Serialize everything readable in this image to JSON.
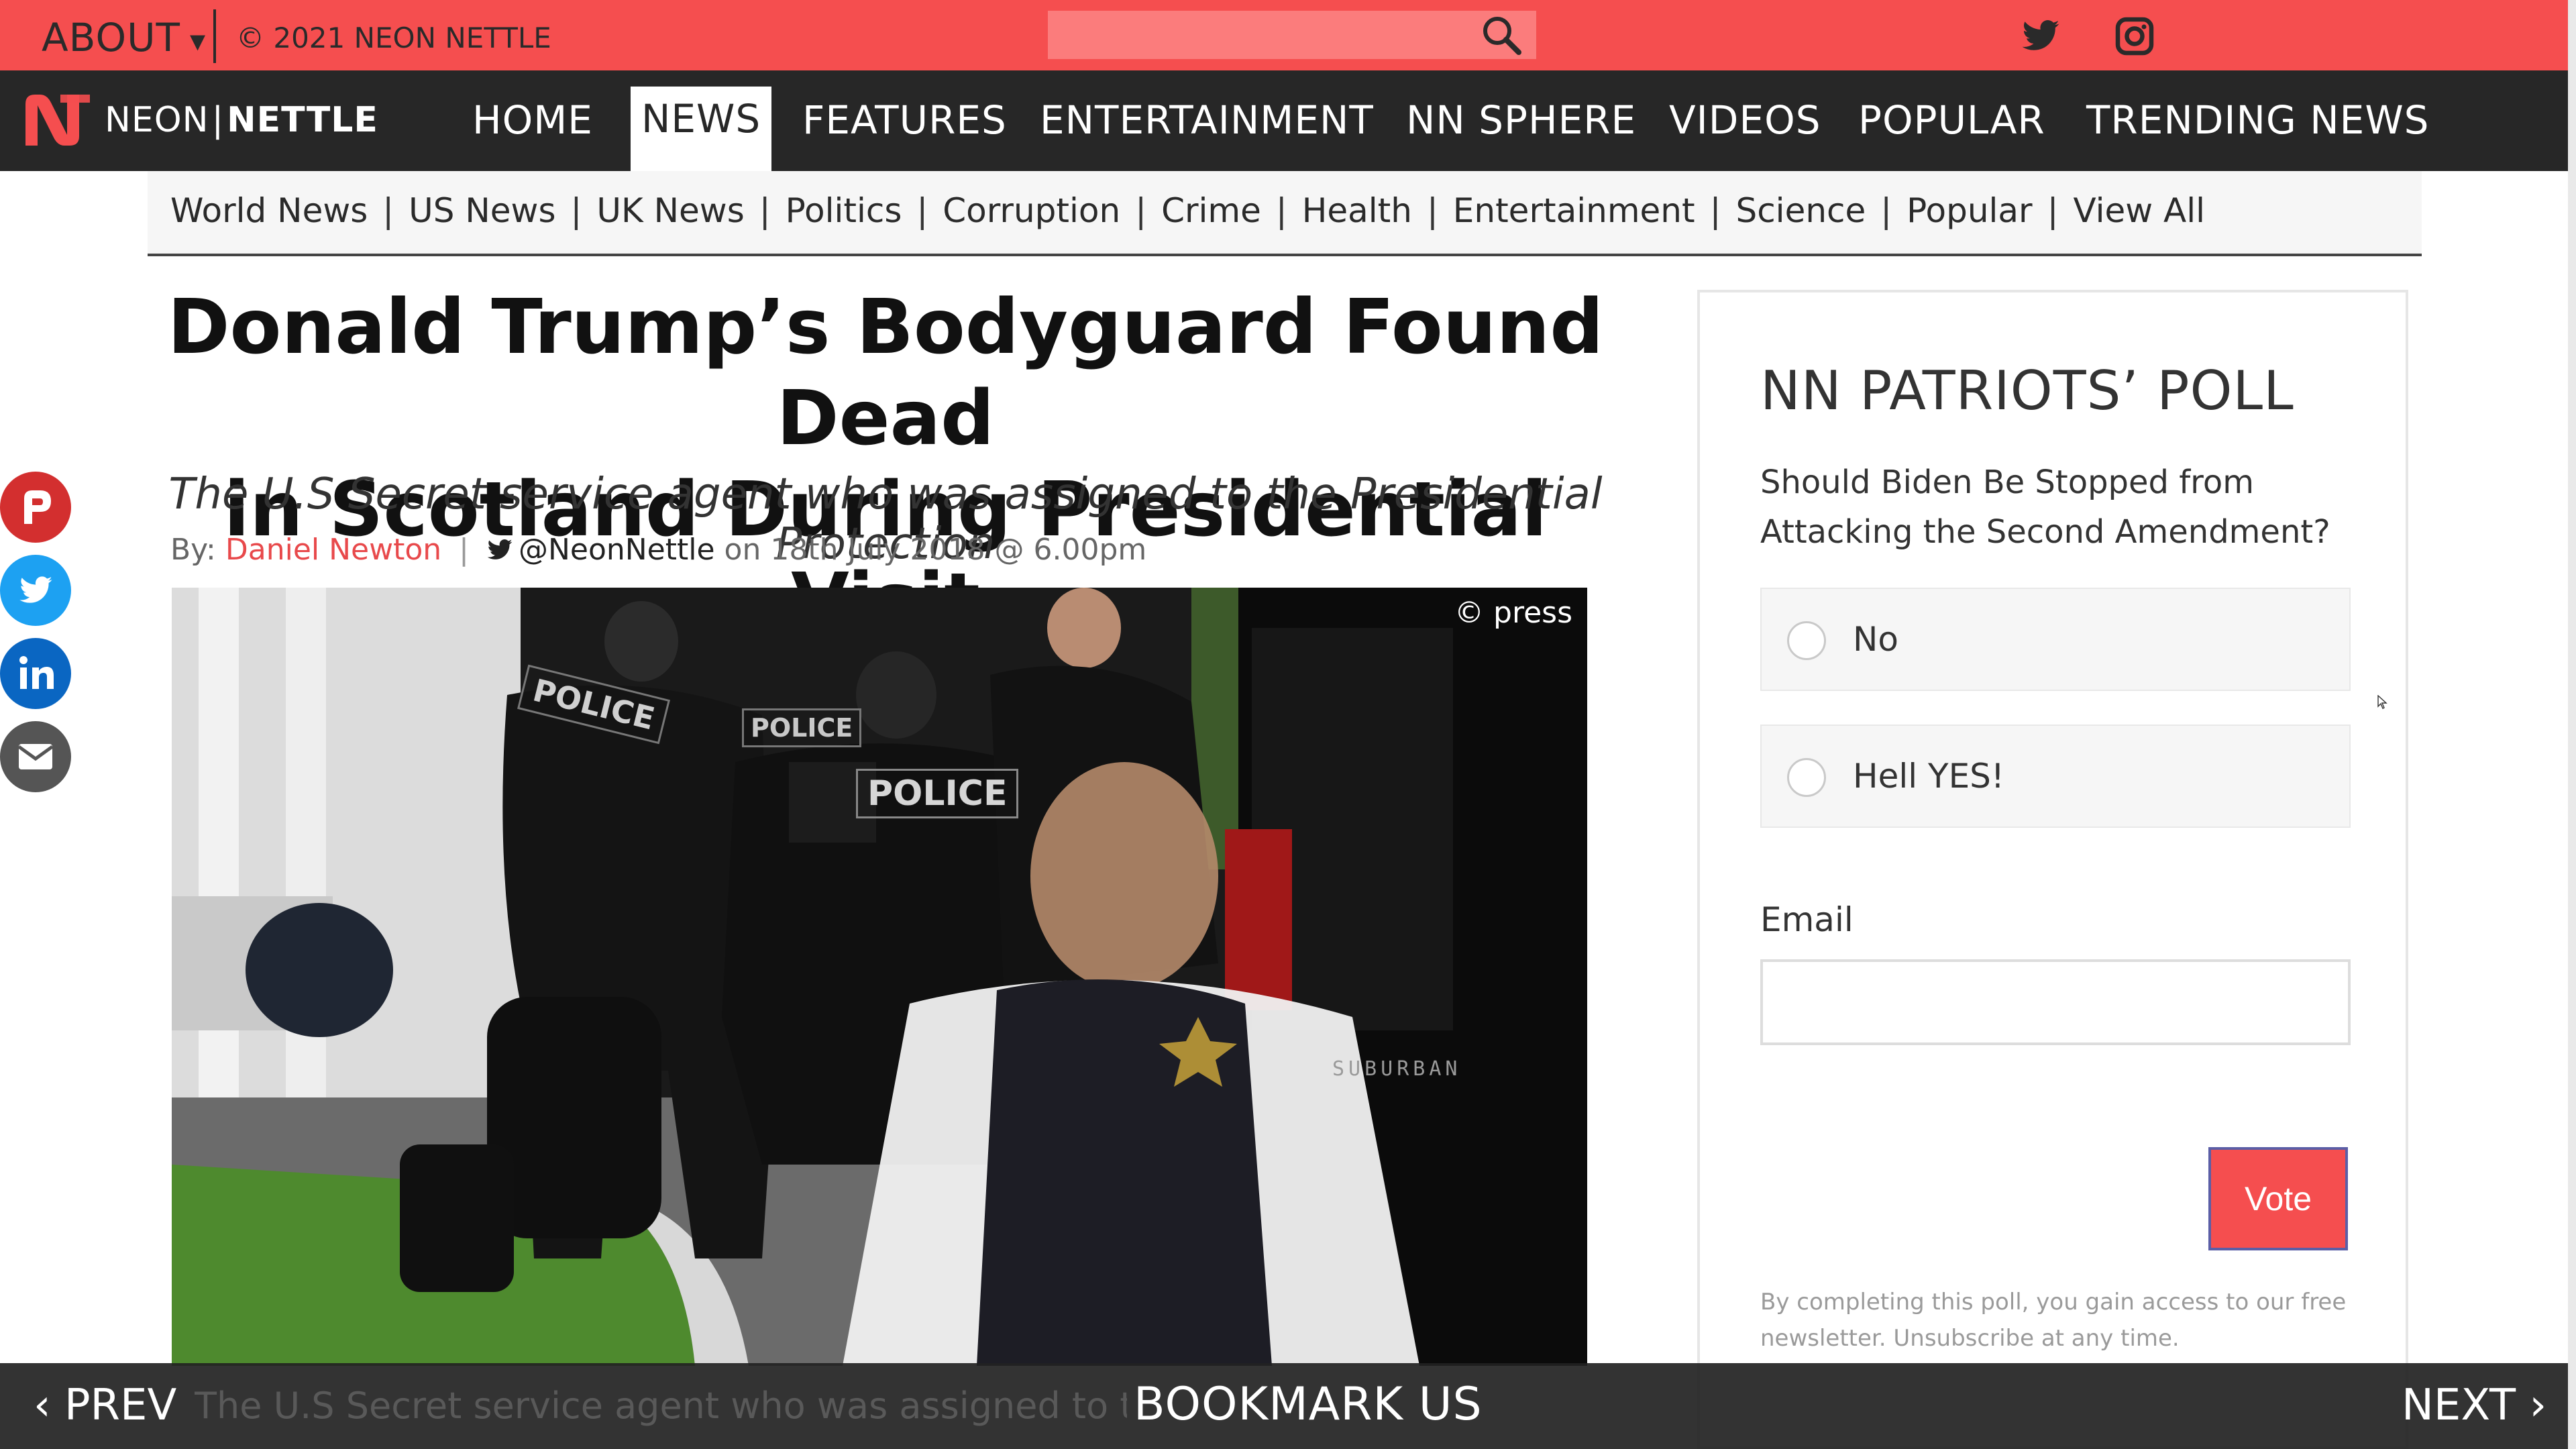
{
  "topbar": {
    "about_label": "ABOUT",
    "about_caret": "▾",
    "copyright": "© 2021 NEON NETTLE",
    "search_placeholder": "",
    "background": "#f54e4f",
    "social_icons": [
      "twitter-icon",
      "instagram-icon"
    ]
  },
  "logo": {
    "part1": "NEON",
    "separator": "|",
    "part2": "NETTLE"
  },
  "nav": {
    "items": [
      {
        "label": "HOME",
        "active": false
      },
      {
        "label": "NEWS",
        "active": true
      },
      {
        "label": "FEATURES",
        "active": false
      },
      {
        "label": "ENTERTAINMENT",
        "active": false
      },
      {
        "label": "NN SPHERE",
        "active": false
      },
      {
        "label": "VIDEOS",
        "active": false
      },
      {
        "label": "POPULAR",
        "active": false
      },
      {
        "label": "TRENDING NEWS",
        "active": false
      }
    ]
  },
  "subnav": {
    "items": [
      "World News",
      "US News",
      "UK News",
      "Politics",
      "Corruption",
      "Crime",
      "Health",
      "Entertainment",
      "Science",
      "Popular",
      "View All"
    ],
    "separator": "|"
  },
  "article": {
    "headline_line1": "Donald Trump’s Bodyguard Found Dead",
    "headline_line2": "in Scotland During Presidential Visit",
    "subheadline": "The U.S Secret service agent who was assigned to the Presidential Protection",
    "by_label": "By:",
    "author": "Daniel Newton",
    "byline_pipe": "|",
    "twitter_handle": "@NeonNettle",
    "date_text": "on 18th July 2018 @ 6.00pm",
    "photo_credit": "© press",
    "photo_badges": [
      "POLICE",
      "POLICE",
      "POLICE",
      "SUBURBAN"
    ]
  },
  "share": {
    "icons": [
      "parler-icon",
      "twitter-icon",
      "linkedin-icon",
      "email-icon"
    ],
    "colors": [
      "#d32f2f",
      "#1da1f2",
      "#0a66c2",
      "#555555"
    ]
  },
  "poll": {
    "title": "NN PATRIOTS’ POLL",
    "question": "Should Biden Be Stopped from Attacking the Second Amendment?",
    "options": [
      "No",
      "Hell YES!"
    ],
    "email_label": "Email",
    "email_value": "",
    "vote_label": "Vote",
    "note": "By completing this poll, you gain access to our free newsletter. Unsubscribe at any time."
  },
  "bottombar": {
    "prev_label": "‹ PREV",
    "ghost_text": "The U.S Secret service agent who was assigned to the Presidential Protection",
    "bookmark_label": "BOOKMARK US",
    "next_label": "NEXT ›"
  },
  "colors": {
    "accent_red": "#f54e4f",
    "nav_dark": "#272727",
    "vote_border": "#5b5ea6"
  }
}
